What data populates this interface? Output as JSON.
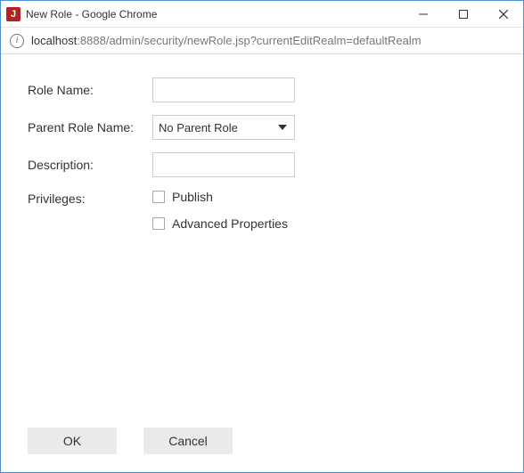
{
  "window": {
    "title": "New Role - Google Chrome",
    "icon_letter": "J"
  },
  "address": {
    "host": "localhost",
    "rest": ":8888/admin/security/newRole.jsp?currentEditRealm=defaultRealm"
  },
  "form": {
    "role_name_label": "Role Name:",
    "role_name_value": "",
    "parent_label": "Parent Role Name:",
    "parent_selected": "No Parent Role",
    "description_label": "Description:",
    "description_value": "",
    "privileges_label": "Privileges:",
    "privileges": {
      "publish_label": "Publish",
      "publish_checked": false,
      "advanced_label": "Advanced Properties",
      "advanced_checked": false
    }
  },
  "buttons": {
    "ok": "OK",
    "cancel": "Cancel"
  }
}
